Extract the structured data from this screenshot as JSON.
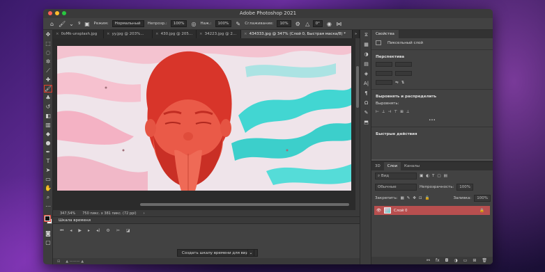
{
  "window": {
    "title": "Adobe Photoshop 2021"
  },
  "options_bar": {
    "mode_label": "Режим:",
    "mode_value": "Нормальный",
    "opacity_label": "Непрозр.:",
    "opacity_value": "100%",
    "pressure_label": "Наж.:",
    "pressure_value": "100%",
    "smoothing_label": "Сглаживание:",
    "smoothing_value": "10%",
    "angle_value": "0°",
    "brush_size": "9"
  },
  "tabs": [
    {
      "label": "0oMk-unsplash.jpg",
      "active": false
    },
    {
      "label": "yy.jpg @ 203%...",
      "active": false
    },
    {
      "label": "430.jpg @ 205...",
      "active": false
    },
    {
      "label": "34223.jpg @ 2...",
      "active": false
    },
    {
      "label": "434333.jpg @ 347% (Слой 0, Быстрая маска/8) *",
      "active": true
    }
  ],
  "status": {
    "zoom": "347,54%",
    "doc_size": "750 пикс. x 381 пикс. (72 ppi)"
  },
  "timeline": {
    "title": "Шкала времени",
    "create_button": "Создать шкалу времени для видео"
  },
  "properties": {
    "tab_label": "Свойства",
    "layer_type": "Пиксельный слой",
    "perspective": "Перспектива",
    "align_distribute": "Выровнять и распределить",
    "align_label": "Выровнять:",
    "quick_actions": "Быстрые действия"
  },
  "layers_panel": {
    "tabs": [
      "3D",
      "Слои",
      "Каналы"
    ],
    "filter_value": "Вид",
    "blend_mode": "Обычные",
    "opacity_label": "Непрозрачность:",
    "opacity_value": "100%",
    "lock_label": "Закрепить:",
    "fill_label": "Заливка:",
    "fill_value": "100%",
    "layer_name": "Слой 0"
  },
  "colors": {
    "accent_red": "#e23b2e",
    "layer_selected": "#b84f4f"
  }
}
